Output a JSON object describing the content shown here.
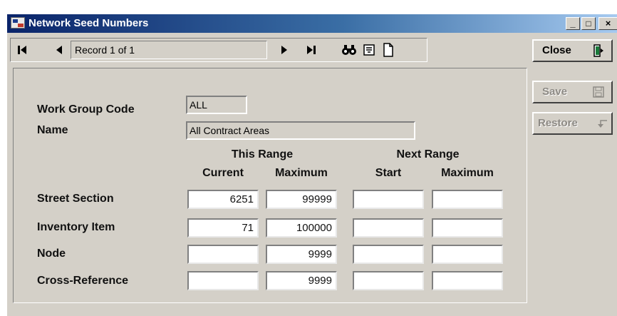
{
  "window": {
    "title": "Network Seed Numbers",
    "minimize_label": "_",
    "maximize_label": "□",
    "close_label": "×"
  },
  "navigation": {
    "record_text": "Record 1 of 1",
    "first_icon": "first-record-icon",
    "prev_icon": "previous-record-icon",
    "next_icon": "next-record-icon",
    "last_icon": "last-record-icon",
    "find_icon": "binoculars-icon",
    "filter_icon": "filter-icon",
    "new_icon": "new-record-icon"
  },
  "side_buttons": {
    "close_label": "Close",
    "save_label": "Save",
    "restore_label": "Restore"
  },
  "form": {
    "work_group_code_label": "Work Group Code",
    "work_group_code_value": "ALL",
    "name_label": "Name",
    "name_value": "All Contract Areas",
    "this_range_label": "This Range",
    "next_range_label": "Next Range",
    "columns": [
      "Current",
      "Maximum",
      "Start",
      "Maximum"
    ],
    "rows": [
      {
        "label": "Street Section",
        "current": "6251",
        "maximum": "99999",
        "next_start": "",
        "next_maximum": ""
      },
      {
        "label": "Inventory Item",
        "current": "71",
        "maximum": "100000",
        "next_start": "",
        "next_maximum": ""
      },
      {
        "label": "Node",
        "current": "",
        "maximum": "9999",
        "next_start": "",
        "next_maximum": ""
      },
      {
        "label": "Cross-Reference",
        "current": "",
        "maximum": "9999",
        "next_start": "",
        "next_maximum": ""
      }
    ]
  },
  "colors": {
    "titlebar_start": "#0a246a",
    "titlebar_end": "#a6caf0",
    "face": "#d4d0c8",
    "disabled_text": "#8d8a85"
  }
}
